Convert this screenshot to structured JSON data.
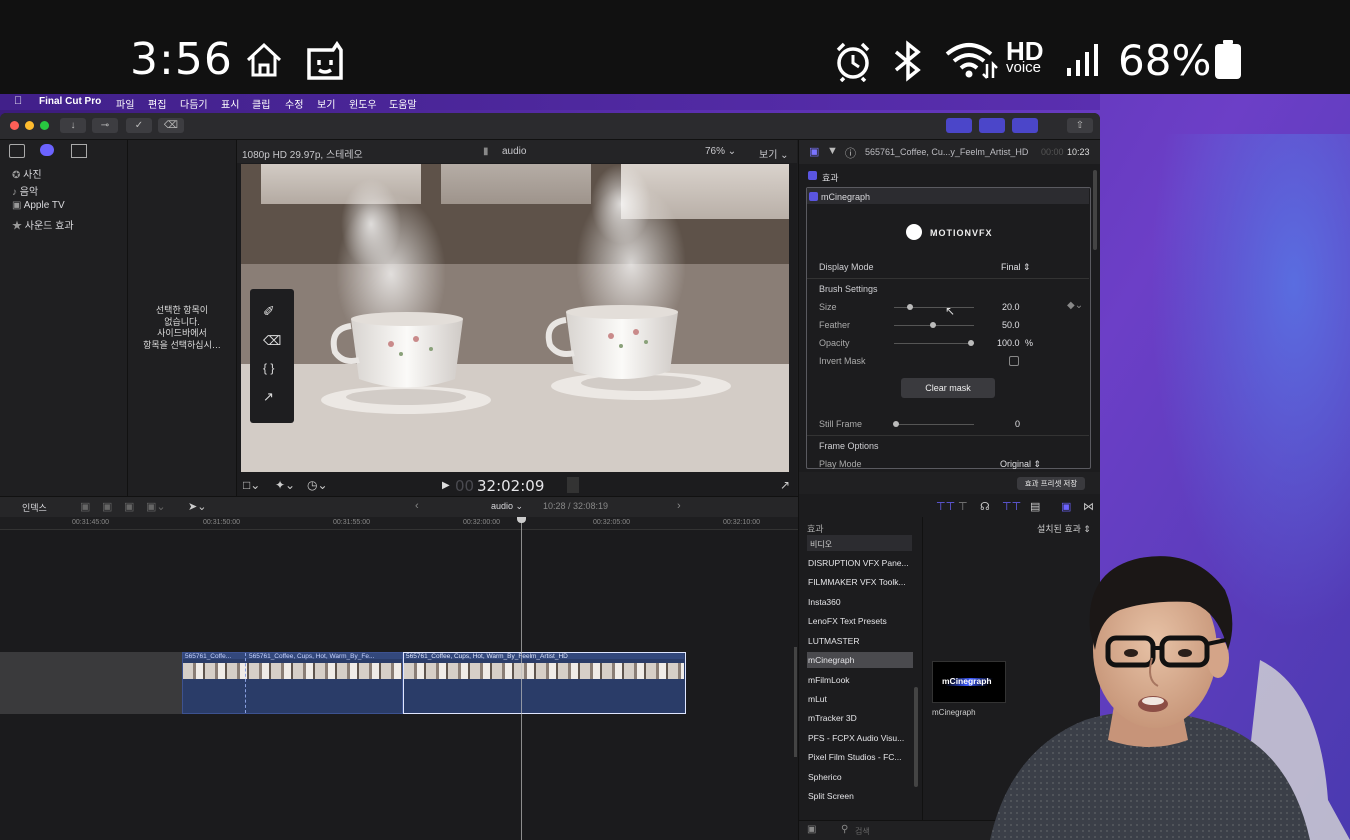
{
  "statusbar": {
    "time": "3:56",
    "hd_top": "HD",
    "hd_bottom": "voice",
    "battery": "68%"
  },
  "menubar": {
    "app_name": "Final Cut Pro",
    "items": [
      "파일",
      "편집",
      "다듬기",
      "표시",
      "클립",
      "수정",
      "보기",
      "윈도우",
      "도움말"
    ]
  },
  "library": {
    "items": [
      "사진",
      "음악",
      "Apple TV",
      "사운드 효과"
    ]
  },
  "browser": {
    "empty_message": [
      "선택한 항목이",
      "없습니다.",
      "사이드바에서",
      "항목을 선택하십시…"
    ]
  },
  "viewer": {
    "format": "1080p HD 29.97p, 스테레오",
    "project": "audio",
    "zoom": "76%",
    "view_menu": "보기",
    "timecode_dim": "00",
    "timecode": "32:02:09"
  },
  "inspector": {
    "clip_name": "565761_Coffee, Cu...y_Feelm_Artist_HD",
    "clip_duration_dim": "00:00",
    "clip_duration": "10:23",
    "effects_label": "효과",
    "effect_name": "mCinegraph",
    "brand": "MOTIONVFX",
    "display_mode_label": "Display Mode",
    "display_mode_value": "Final",
    "brush_settings": "Brush Settings",
    "size_label": "Size",
    "size_value": "20.0",
    "feather_label": "Feather",
    "feather_value": "50.0",
    "opacity_label": "Opacity",
    "opacity_value": "100.0",
    "opacity_unit": "%",
    "invert_mask_label": "Invert Mask",
    "clear_mask": "Clear mask",
    "still_frame_label": "Still Frame",
    "still_frame_value": "0",
    "frame_options": "Frame Options",
    "play_mode_label": "Play Mode",
    "play_mode_value": "Original",
    "save_preset": "효과 프리셋 저장"
  },
  "timeline": {
    "index_label": "인덱스",
    "project": "audio",
    "position": "10:28 / 32:08:19",
    "ruler": [
      "00:31:45:00",
      "00:31:50:00",
      "00:31:55:00",
      "00:32:00:00",
      "00:32:05:00",
      "00:32:10:00"
    ],
    "clips": [
      "565761_Coffe...",
      "565761_Coffee, Cups, Hot, Warm_By_Fe...",
      "565761_Coffee, Cups, Hot, Warm_By_Feelm_Artist_HD"
    ]
  },
  "effects_browser": {
    "header": "효과",
    "installed": "설치된 효과",
    "category": "비디오",
    "items": [
      "DISRUPTION VFX Pane...",
      "FILMMAKER VFX Toolk...",
      "Insta360",
      "LenoFX Text Presets",
      "LUTMASTER",
      "mCinegraph",
      "mFilmLook",
      "mLut",
      "mTracker 3D",
      "PFS - FCPX Audio Visu...",
      "Pixel Film Studios - FC...",
      "Spherico",
      "Split Screen"
    ],
    "selected": "mCinegraph",
    "thumb_label": "mCinegraph",
    "thumb_caption": "mCinegraph",
    "search_placeholder": "검색"
  }
}
